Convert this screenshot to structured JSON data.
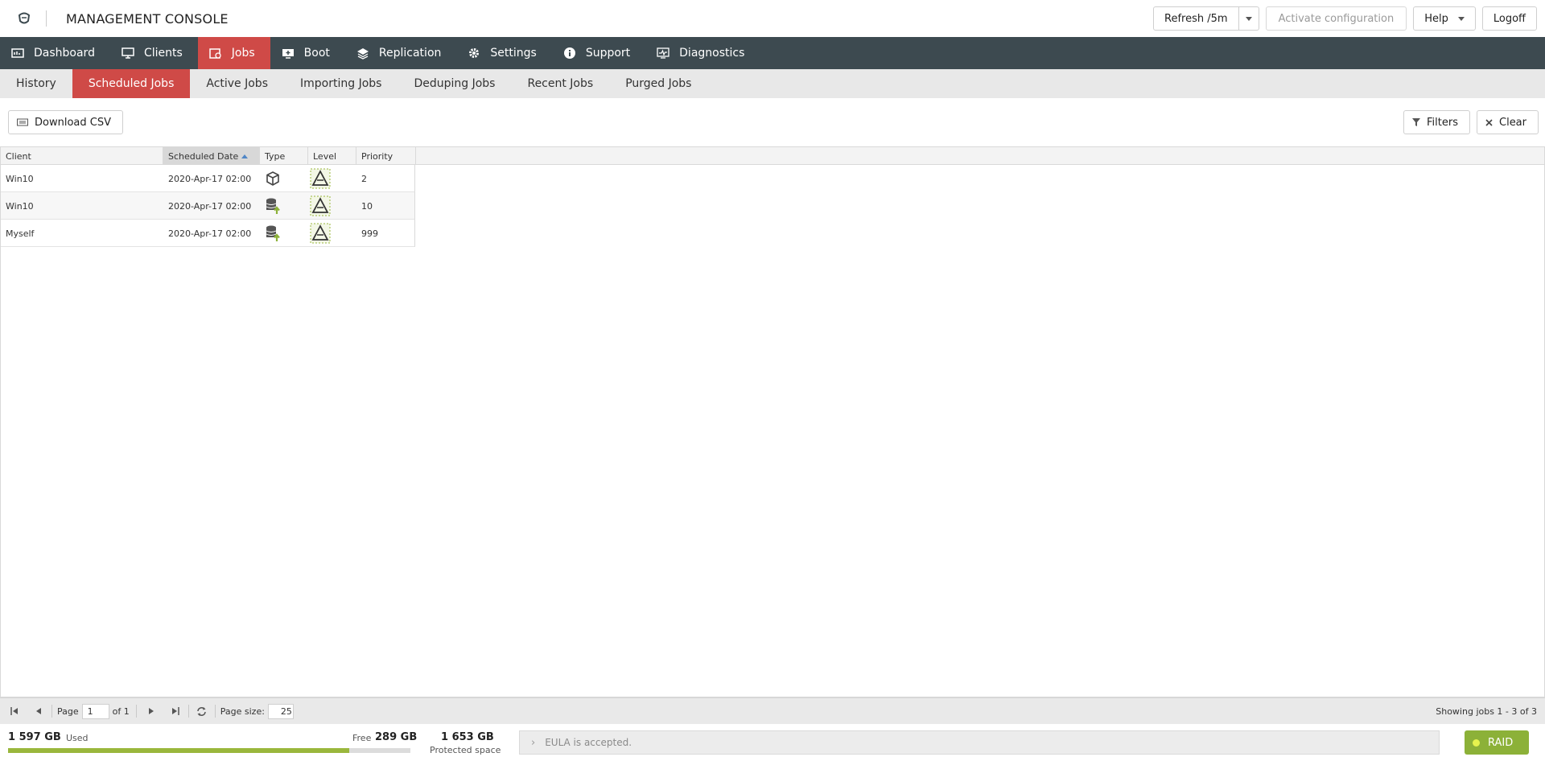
{
  "header": {
    "title": "MANAGEMENT CONSOLE",
    "refresh_label": "Refresh /5m",
    "activate_label": "Activate configuration",
    "help_label": "Help",
    "logoff_label": "Logoff"
  },
  "mainnav": {
    "items": [
      {
        "label": "Dashboard",
        "icon": "dashboard-icon"
      },
      {
        "label": "Clients",
        "icon": "monitor-icon"
      },
      {
        "label": "Jobs",
        "icon": "jobs-icon",
        "active": true
      },
      {
        "label": "Boot",
        "icon": "boot-icon"
      },
      {
        "label": "Replication",
        "icon": "layers-icon"
      },
      {
        "label": "Settings",
        "icon": "gear-icon"
      },
      {
        "label": "Support",
        "icon": "info-icon"
      },
      {
        "label": "Diagnostics",
        "icon": "diagnostics-icon"
      }
    ]
  },
  "subnav": {
    "items": [
      {
        "label": "History"
      },
      {
        "label": "Scheduled Jobs",
        "active": true
      },
      {
        "label": "Active Jobs"
      },
      {
        "label": "Importing Jobs"
      },
      {
        "label": "Deduping Jobs"
      },
      {
        "label": "Recent Jobs"
      },
      {
        "label": "Purged Jobs"
      }
    ]
  },
  "toolbar": {
    "download_label": "Download CSV",
    "filters_label": "Filters",
    "clear_label": "Clear"
  },
  "table": {
    "columns": [
      "Client",
      "Scheduled Date",
      "Type",
      "Level",
      "Priority"
    ],
    "rows": [
      {
        "client": "Win10",
        "date": "2020-Apr-17 02:00",
        "type": "box-icon",
        "level": "full-level-icon",
        "priority": "2"
      },
      {
        "client": "Win10",
        "date": "2020-Apr-17 02:00",
        "type": "database-backup-icon",
        "level": "full-level-icon",
        "priority": "10"
      },
      {
        "client": "Myself",
        "date": "2020-Apr-17 02:00",
        "type": "database-backup-icon",
        "level": "full-level-icon",
        "priority": "999"
      }
    ]
  },
  "pager": {
    "page_label": "Page",
    "page_value": "1",
    "of_label": "of 1",
    "page_size_label": "Page size:",
    "page_size_value": "25",
    "summary": "Showing jobs 1 - 3 of 3"
  },
  "storage": {
    "used_value": "1 597 GB",
    "used_label": "Used",
    "free_label": "Free",
    "free_value": "289 GB",
    "used_fraction": 0.847,
    "protected_value": "1 653 GB",
    "protected_label": "Protected space",
    "eula_text": "EULA is accepted.",
    "raid_label": "RAID",
    "colors": {
      "bar_fill": "#9ab73c",
      "raid": "#8cb138",
      "accent_red": "#cf4a47",
      "nav_bg": "#3d4a50"
    }
  }
}
